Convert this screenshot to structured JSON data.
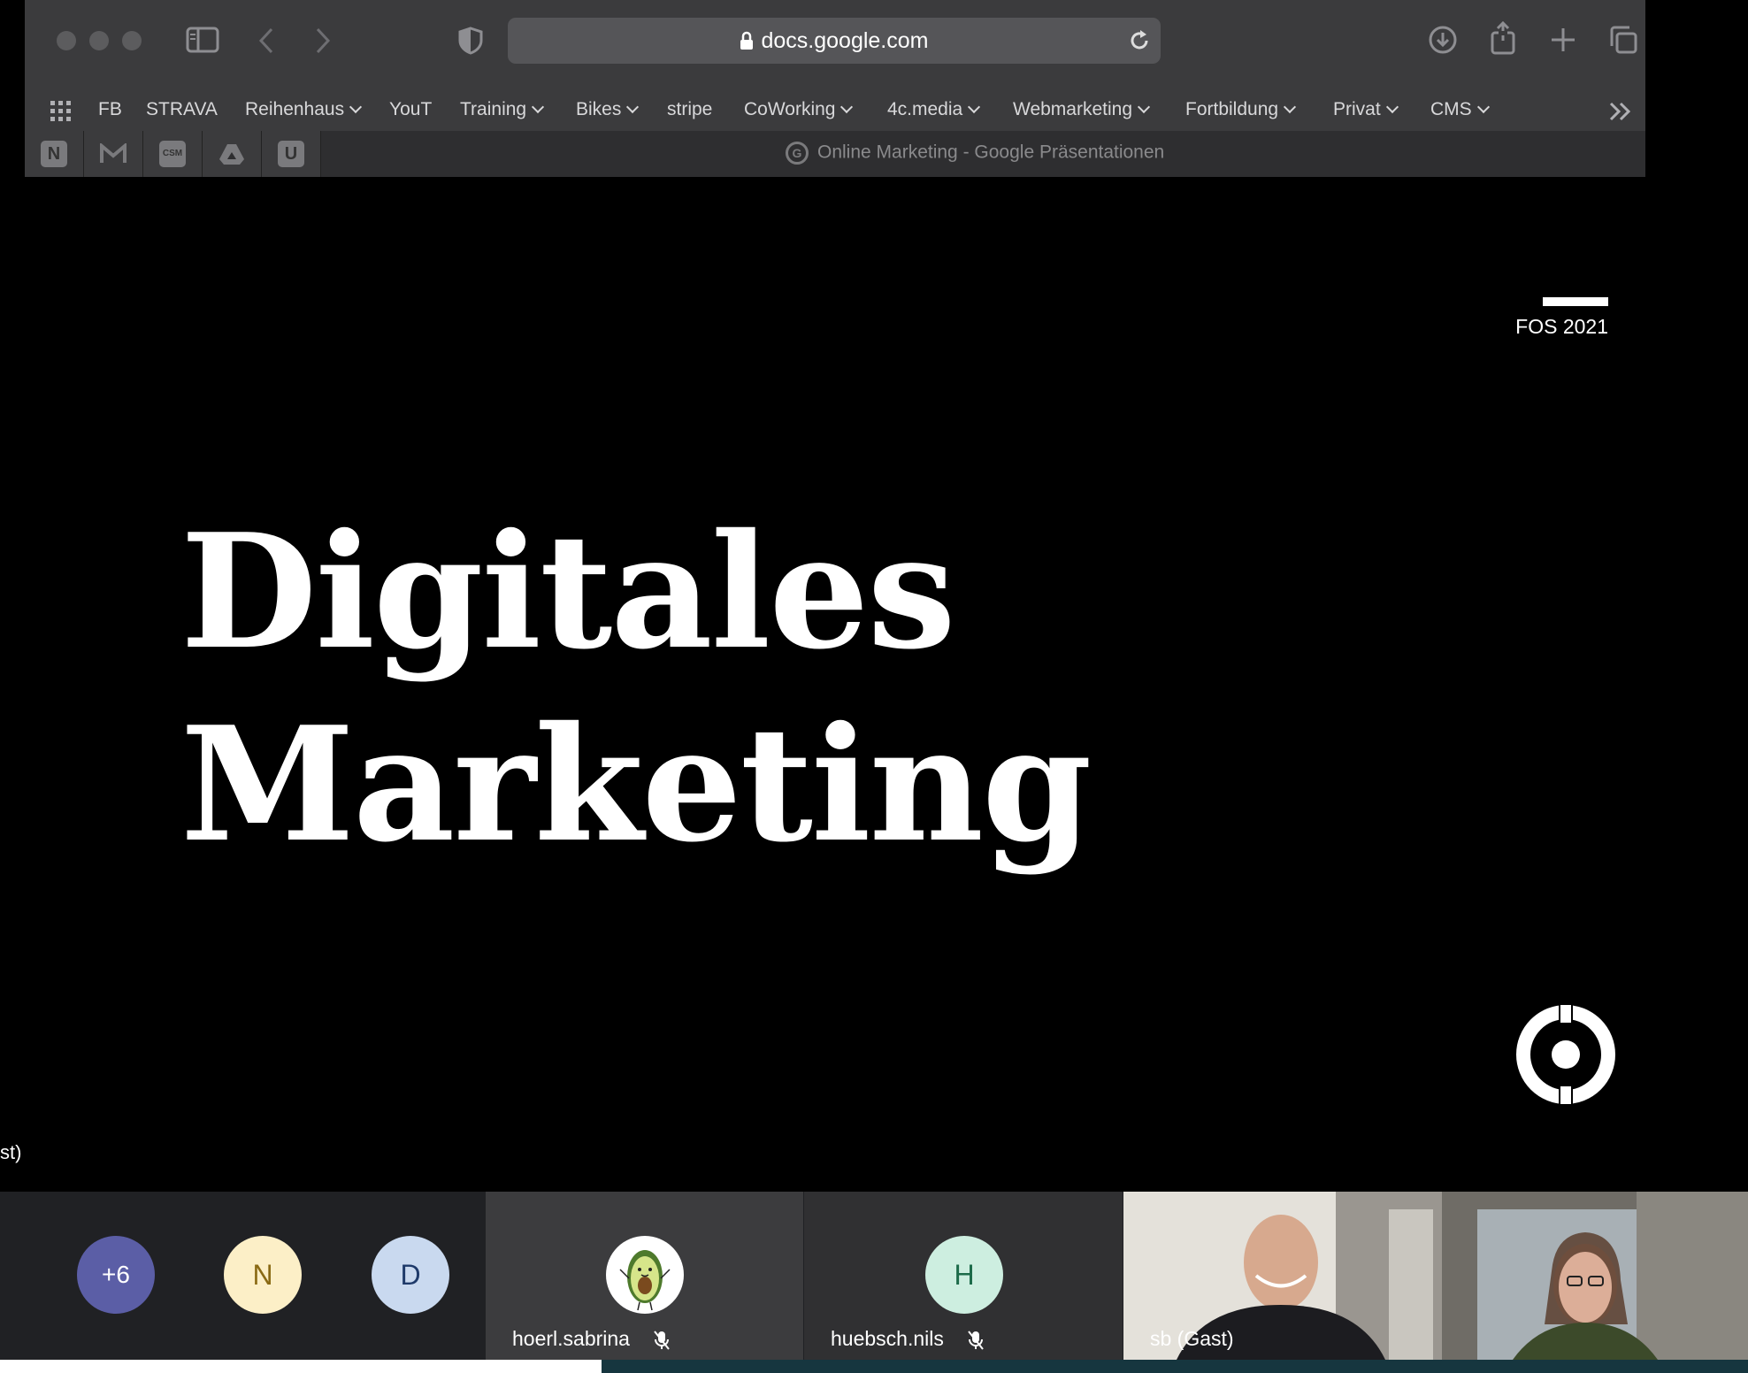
{
  "browser": {
    "url": "docs.google.com",
    "bookmarks": [
      {
        "label": "FB",
        "dropdown": false
      },
      {
        "label": "STRAVA",
        "dropdown": false
      },
      {
        "label": "Reihenhaus",
        "dropdown": true
      },
      {
        "label": "YouT",
        "dropdown": false
      },
      {
        "label": "Training",
        "dropdown": true
      },
      {
        "label": "Bikes",
        "dropdown": true
      },
      {
        "label": "stripe",
        "dropdown": false
      },
      {
        "label": "CoWorking",
        "dropdown": true
      },
      {
        "label": "4c.media",
        "dropdown": true
      },
      {
        "label": "Webmarketing",
        "dropdown": true
      },
      {
        "label": "Fortbildung",
        "dropdown": true
      },
      {
        "label": "Privat",
        "dropdown": true
      },
      {
        "label": "CMS",
        "dropdown": true
      }
    ],
    "active_tab_title": "Online Marketing - Google Präsentationen",
    "icons": [
      "sidebar-icon",
      "back-icon",
      "forward-icon",
      "shield-icon",
      "lock-icon",
      "reload-icon",
      "download-icon",
      "share-icon",
      "new-tab-icon",
      "tab-overview-icon",
      "apps-grid-icon",
      "overflow-chevrons-icon"
    ]
  },
  "slide": {
    "tag": "FOS 2021",
    "title_line1": "Digitales",
    "title_line2": "Marketing"
  },
  "meeting": {
    "left_label": "st)",
    "overflow_count": "+6",
    "participants": [
      {
        "initial": "N",
        "color": "#fcefc7",
        "text_color": "#8a6a14"
      },
      {
        "initial": "D",
        "color": "#c9d9ef",
        "text_color": "#1e3a6a"
      },
      {
        "name": "hoerl.sabrina",
        "avatar": "avocado-avatar",
        "muted": true
      },
      {
        "name": "huebsch.nils",
        "initial": "H",
        "color": "#cdeee0",
        "text_color": "#1c6b4a",
        "muted": true
      },
      {
        "name": "sb (Gast)",
        "video": true
      }
    ]
  }
}
